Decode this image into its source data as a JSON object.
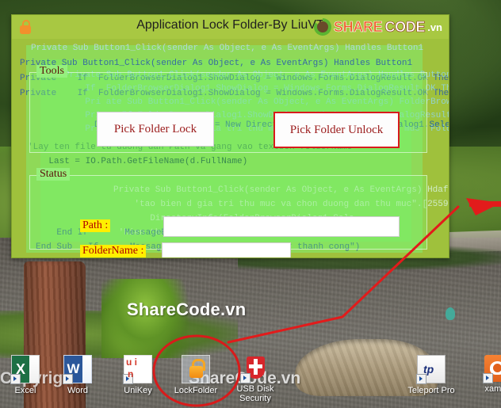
{
  "window": {
    "title": "Application Lock Folder-By LiuVT",
    "lock_icon": "lock-icon",
    "logo": {
      "mark": "sharecode-logo-icon",
      "share": "SHARE",
      "code": "CODE",
      "vn": ".vn"
    }
  },
  "tools": {
    "group_label": "Tools",
    "pick_folder_lock": "Pick Folder Lock",
    "pick_folder_unlock": "Pick Folder Unlock"
  },
  "status": {
    "group_label": "Status",
    "path_label": "Path :",
    "path_value": "",
    "path_placeholder": "",
    "foldername_label": "FolderName :",
    "foldername_value": "",
    "foldername_placeholder": ""
  },
  "code_background": {
    "line_a": "Private Sub Button1_Click(sender As Object, e As EventArgs) Handles Button1",
    "line_b": "Private Sub Button1_Click(sender As Object, e As EventArgs) Handles Button1\nPrivate    If  FolderBrowserDialog1.ShowDialog = Windows.Forms.DialogResult.OK Then\nPrivate    If  FolderBrowserDialog1.ShowDialog = Windows.Forms.DialogResult.OK Then",
    "line_c": "Private Sub Button1_Click(sender As Object, e As EventArgs) Handles Button1\n    If  FolderBrowserDialog1.ShowDialog = Windows.Forms.DialogResult.OK Then\n    Pri ate Sub Button1_Click(sender As Object, e As EventArgs) FolderBrowserDialog1.Sele\n    Pri    If FolderBrowserDialog1.ShowDialog = Windows.Forms.DialogResult.OK Then\n    Pri        'tao bien d gia tri thu muc va chon duong dan thu muc  FolderBrowserDialog1.Sele",
    "line_d": "Dim d As DirectoryInfo = New DirectoryInfo(FolderBrowserDialog1.Sele",
    "line_e": "'Lay ten file tu duong dan Path va gang vao textbox folderName\n    Last = IO.Path.GetFileName(d.FullName)",
    "line_f": "Private Sub Button1_Click(sender As Object, e As EventArgs) Hdaf-00d\n    'tao bien d gia tri thu muc va chon duong dan thu muc\".[2559\n       DirectoryInfo(FolderBrowserDialog1.Sele\n 'hien thi duong dan tren textbox Path",
    "line_g": "    End If       MessageBox.Show(\"Da khoa folder thanh cong\")\nEnd Sub   If      MessageBox.Show(\"Da khoa folder thanh cong\")"
  },
  "desktop": {
    "watermark_center": "ShareCode.vn",
    "watermark_copyright_right": "ShareCode.vn",
    "watermark_copyright_left": "Copyright",
    "icons": [
      {
        "name": "excel",
        "label": "Excel",
        "glyph": "excel-icon"
      },
      {
        "name": "word",
        "label": "Word",
        "glyph": "word-icon"
      },
      {
        "name": "unikey",
        "label": "UniKey",
        "glyph": "unikey-icon"
      },
      {
        "name": "lockfolder",
        "label": "LockFolder",
        "glyph": "lock-folder-icon"
      },
      {
        "name": "usb-disk-security",
        "label": "USB Disk Security",
        "glyph": "shield-icon"
      },
      {
        "name": "teleport-pro",
        "label": "Teleport Pro",
        "glyph": "teleport-pro-icon"
      },
      {
        "name": "xampp",
        "label": "xampp",
        "glyph": "xampp-icon"
      }
    ]
  },
  "annotation": {
    "circle_color": "#d81b1b",
    "arrow_color": "#e21b1b",
    "target": "lockfolder"
  },
  "colors": {
    "window_bg": "#9fc13c",
    "title_bg": "#a8c842",
    "accent_red": "#d81b1b",
    "label_highlight": "#ffef00",
    "button_text": "#9b1b1b"
  }
}
